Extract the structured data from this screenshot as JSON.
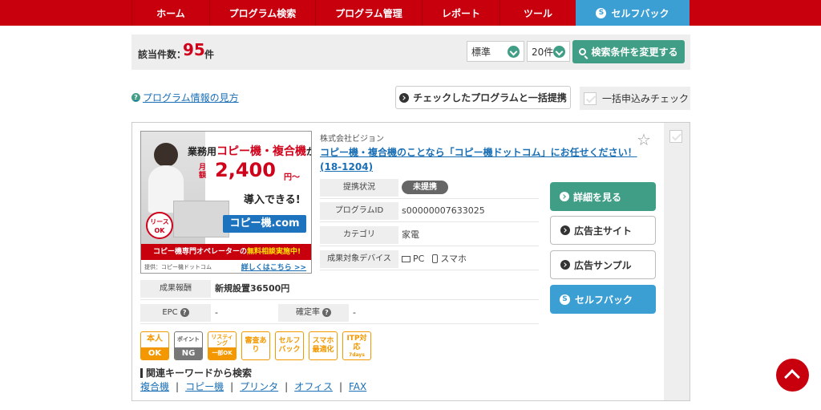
{
  "nav": {
    "items": [
      "ホーム",
      "プログラム検索",
      "プログラム管理",
      "レポート",
      "ツール",
      "セルフバック"
    ],
    "active_index": 5
  },
  "results": {
    "count_label": "該当件数：",
    "count": "95",
    "count_unit": "件",
    "sort_select": "標準",
    "per_page_select": "20件",
    "change_search_label": "検索条件を変更する"
  },
  "help_link": "プログラム情報の見方",
  "bulk_apply_label": "チェックしたプログラムと一括提携",
  "bulk_check_label": "一括申込みチェック",
  "program": {
    "advertiser": "株式会社ビジョン",
    "title": "コピー機・複合機のことなら「コピー機ドットコム」にお任せください！(18-1204)",
    "banner": {
      "line1_prefix": "業務用",
      "line1_main": "コピー機・複合機",
      "line1_suffix": "が",
      "month": "月額",
      "price": "2,400",
      "yen": "円〜",
      "line2": "導入できる!",
      "lease": "リース OK",
      "logo": "コピー機.com",
      "strip_prefix": "コピー機専門オペレーターの",
      "strip_highlight": "無料相談実施中!",
      "credit": "提供：コピー機ドットコム",
      "more": "詳しくはこちら >>"
    },
    "info": [
      {
        "label": "提携状況",
        "value": "未提携"
      },
      {
        "label": "プログラムID",
        "value": "s00000007633025"
      },
      {
        "label": "カテゴリ",
        "value": "家電"
      },
      {
        "label": "成果対象デバイス",
        "pc": "PC",
        "sp": "スマホ"
      }
    ],
    "reward": {
      "label": "成果報酬",
      "value": "新規設置36500円",
      "epc_label": "EPC",
      "epc_value": "-",
      "rate_label": "確定率",
      "rate_value": "-"
    },
    "actions": {
      "details": "詳細を見る",
      "advertiser_site": "広告主サイト",
      "ad_sample": "広告サンプル",
      "selfback": "セルフバック"
    },
    "tags": [
      {
        "top": "本人",
        "bottom": "OK"
      },
      {
        "top": "ポイント",
        "bottom": "NG"
      },
      {
        "top": "リスティング",
        "bottom": "一部OK"
      },
      {
        "text": "審査あり"
      },
      {
        "text": "セルフバック"
      },
      {
        "text": "スマホ最適化"
      },
      {
        "text": "ITP対応",
        "sub": "7days"
      }
    ],
    "keywords_title": "関連キーワードから検索",
    "keywords": [
      "複合機",
      "コピー機",
      "プリンタ",
      "オフィス",
      "FAX"
    ]
  },
  "colors": {
    "nav_red": "#c8000e",
    "active_blue": "#3c9fd4",
    "green": "#3f9e85",
    "count_red": "#d0021b",
    "tag_orange": "#f39800"
  }
}
